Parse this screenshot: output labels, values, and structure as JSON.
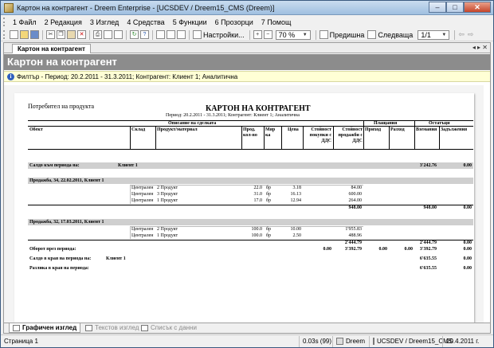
{
  "window": {
    "title": "Картон на контрагент - Dreem Enterprise - [UCSDEV / Dreem15_CMS (Dreem)]",
    "minimize": "–",
    "maximize": "□",
    "close": "✕"
  },
  "menu": [
    "1 Файл",
    "2 Редакция",
    "3 Изглед",
    "4 Средства",
    "5 Функции",
    "6 Прозорци",
    "7 Помощ"
  ],
  "toolbar": {
    "settings_label": "Настройки...",
    "zoom_value": "70 %",
    "prev_label": "Предишна",
    "next_label": "Следваща",
    "page_value": "1/1"
  },
  "doc_tab": {
    "label": "Картон на контрагент"
  },
  "header_band": {
    "title": "Картон на контрагент"
  },
  "filter": {
    "text": "Филтър - Период: 20.2.2011 - 31.3.2011; Контрагент: Клиент 1; Аналитична"
  },
  "report": {
    "product_consumer": "Потребител на продукта",
    "title": "КАРТОН НА КОНТРАГЕНТ",
    "subtitle": "Период: 20.2.2011 - 31.3.2011; Контрагент: Клиент 1; Аналитична",
    "group_headers": {
      "description": "Описание на сделката",
      "payments": "Плащания",
      "balances": "Остатъци"
    },
    "columns": {
      "object": "Обект",
      "warehouse": "Склад",
      "product": "Продукт/материал",
      "qty": "Прод. кол-во",
      "unit": "Мяр ка",
      "price": "Цена",
      "purchase_value": "Стойност покупки с ДДС",
      "sales_value": "Стойност продажби с ДДС",
      "income": "Приход",
      "expense": "Разход",
      "owed": "Вземания",
      "liabilities": "Задължения"
    },
    "opening": {
      "label": "Салдо към периода на:",
      "client": "Клиент 1",
      "owed": "3'242.76",
      "liab": "0.00"
    },
    "sales": [
      {
        "title": "Продажба, 34, 22.02.2011, Клиент 1",
        "lines": [
          {
            "warehouse": "Централен",
            "product": "2 Продукт",
            "qty": "22.0",
            "unit": "бр",
            "price": "3.18",
            "sales": "84.00"
          },
          {
            "warehouse": "Централен",
            "product": "3 Продукт",
            "qty": "31.0",
            "unit": "бр",
            "price": "16.13",
            "sales": "600.00"
          },
          {
            "warehouse": "Централен",
            "product": "1 Продукт",
            "qty": "17.0",
            "unit": "бр",
            "price": "12.94",
            "sales": "264.00"
          }
        ],
        "total_sales": "948.00",
        "total_owed": "948.00",
        "total_liab": "0.00"
      },
      {
        "title": "Продажба, 32, 17.03.2011, Клиент 1",
        "lines": [
          {
            "warehouse": "Централен",
            "product": "2 Продукт",
            "qty": "100.0",
            "unit": "бр",
            "price": "10.00",
            "sales": "1'955.83"
          },
          {
            "warehouse": "Централен",
            "product": "1 Продукт",
            "qty": "100.0",
            "unit": "бр",
            "price": "2.50",
            "sales": "488.96"
          }
        ],
        "total_sales": "2'444.79",
        "total_owed": "2'444.79",
        "total_liab": "0.00"
      }
    ],
    "turnover": {
      "label": "Оборот през периода:",
      "purchases": "0.00",
      "sales": "3'392.79",
      "income": "0.00",
      "expense": "0.00",
      "owed": "3'392.79",
      "liab": "0.00"
    },
    "closing": {
      "label": "Салдо в края на периода на:",
      "client": "Клиент 1",
      "owed": "6'635.55",
      "liab": "0.00"
    },
    "difference": {
      "label": "Разлика в края на периода:",
      "owed": "6'635.55",
      "liab": "0.00"
    }
  },
  "bottom_tabs": [
    "Графичен изглед",
    "Текстов изглед",
    "Списък с данни"
  ],
  "status": {
    "page": "Страница 1",
    "time": "0.03s (99)",
    "app": "Dreem",
    "db": "UCSDEV / Dreem15_CMS",
    "date": "20.4.2011 г."
  }
}
